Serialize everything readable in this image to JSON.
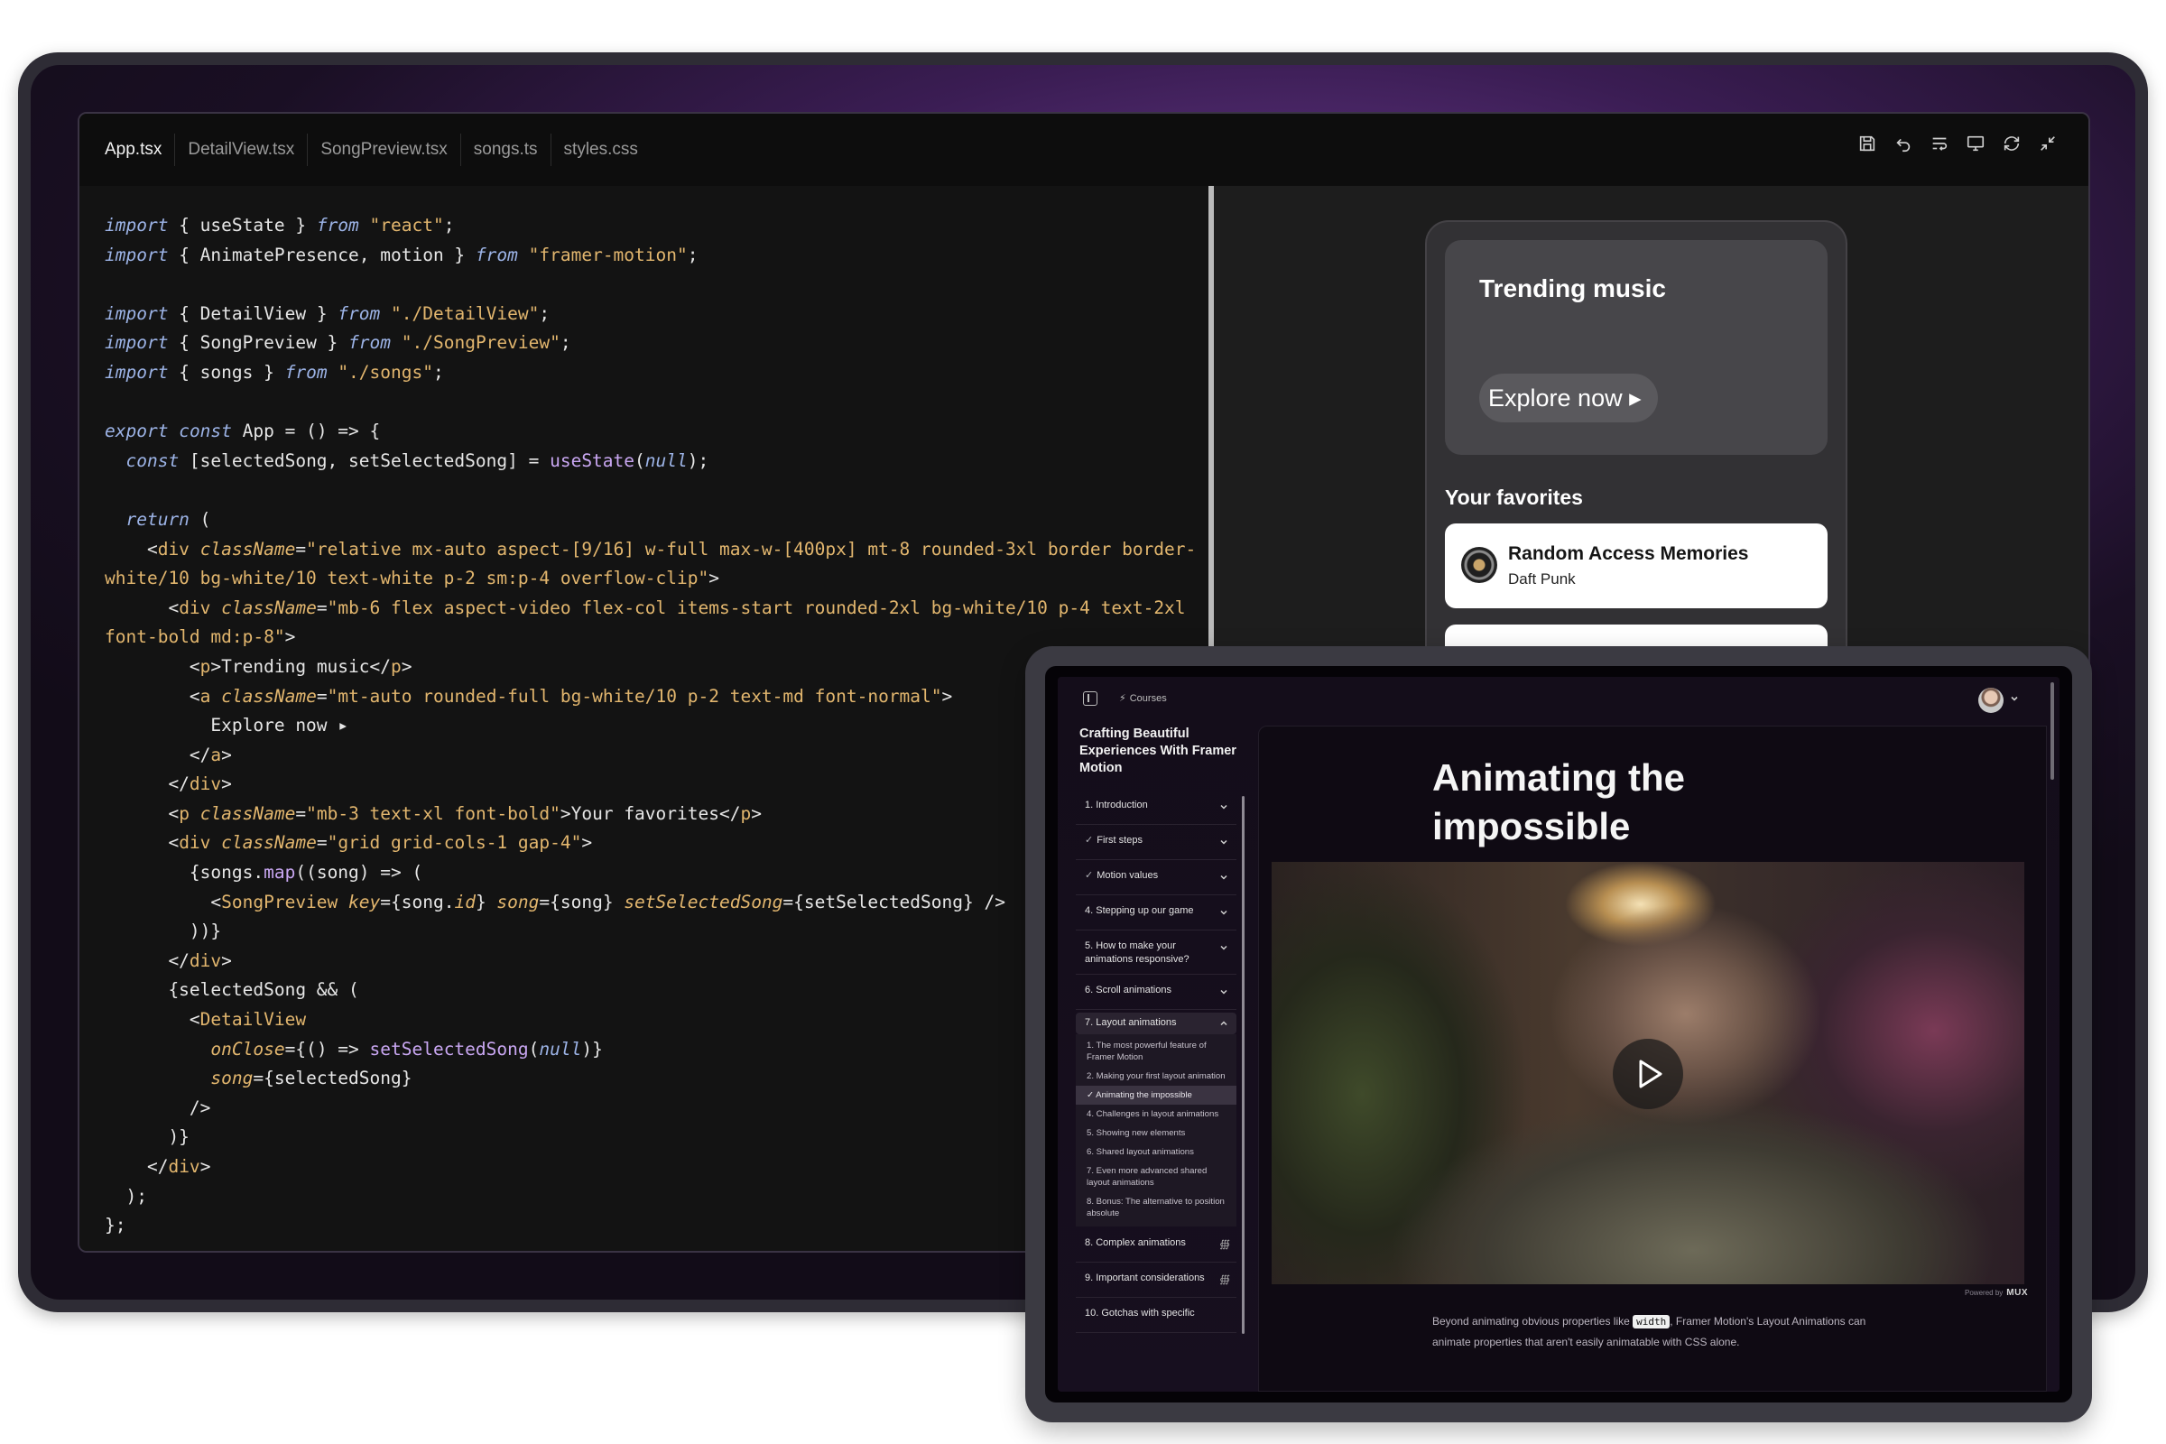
{
  "editor": {
    "tabs": [
      "App.tsx",
      "DetailView.tsx",
      "SongPreview.tsx",
      "songs.ts",
      "styles.css"
    ],
    "toolbar_icons": [
      "save-icon",
      "undo-icon",
      "wrap-icon",
      "preview-icon",
      "refresh-icon",
      "collapse-icon"
    ],
    "code_lines": [
      [
        [
          "kw",
          "import"
        ],
        [
          "t",
          " { useState } "
        ],
        [
          "kw",
          "from"
        ],
        [
          "t",
          " "
        ],
        [
          "str",
          "\"react\""
        ],
        [
          "t",
          ";"
        ]
      ],
      [
        [
          "kw",
          "import"
        ],
        [
          "t",
          " { AnimatePresence, motion } "
        ],
        [
          "kw",
          "from"
        ],
        [
          "t",
          " "
        ],
        [
          "str",
          "\"framer-motion\""
        ],
        [
          "t",
          ";"
        ]
      ],
      [],
      [
        [
          "kw",
          "import"
        ],
        [
          "t",
          " { DetailView } "
        ],
        [
          "kw",
          "from"
        ],
        [
          "t",
          " "
        ],
        [
          "str",
          "\"./DetailView\""
        ],
        [
          "t",
          ";"
        ]
      ],
      [
        [
          "kw",
          "import"
        ],
        [
          "t",
          " { SongPreview } "
        ],
        [
          "kw",
          "from"
        ],
        [
          "t",
          " "
        ],
        [
          "str",
          "\"./SongPreview\""
        ],
        [
          "t",
          ";"
        ]
      ],
      [
        [
          "kw",
          "import"
        ],
        [
          "t",
          " { songs } "
        ],
        [
          "kw",
          "from"
        ],
        [
          "t",
          " "
        ],
        [
          "str",
          "\"./songs\""
        ],
        [
          "t",
          ";"
        ]
      ],
      [],
      [
        [
          "kw",
          "export"
        ],
        [
          "t",
          " "
        ],
        [
          "kw",
          "const"
        ],
        [
          "t",
          " App = () => {"
        ]
      ],
      [
        [
          "t",
          "  "
        ],
        [
          "kw",
          "const"
        ],
        [
          "t",
          " [selectedSong, setSelectedSong] = "
        ],
        [
          "fn",
          "useState"
        ],
        [
          "t",
          "("
        ],
        [
          "nl",
          "null"
        ],
        [
          "t",
          ");"
        ]
      ],
      [],
      [
        [
          "t",
          "  "
        ],
        [
          "kw",
          "return"
        ],
        [
          "t",
          " ("
        ]
      ],
      [
        [
          "t",
          "    <"
        ],
        [
          "tag",
          "div"
        ],
        [
          "t",
          " "
        ],
        [
          "attr",
          "className"
        ],
        [
          "t",
          "="
        ],
        [
          "str",
          "\"relative mx-auto aspect-[9/16] w-full max-w-[400px] mt-8 rounded-3xl border border-"
        ]
      ],
      [
        [
          "str",
          "white/10 bg-white/10 text-white p-2 sm:p-4 overflow-clip\""
        ],
        [
          "t",
          ">"
        ]
      ],
      [
        [
          "t",
          "      <"
        ],
        [
          "tag",
          "div"
        ],
        [
          "t",
          " "
        ],
        [
          "attr",
          "className"
        ],
        [
          "t",
          "="
        ],
        [
          "str",
          "\"mb-6 flex aspect-video flex-col items-start rounded-2xl bg-white/10 p-4 text-2xl"
        ]
      ],
      [
        [
          "str",
          "font-bold md:p-8\""
        ],
        [
          "t",
          ">"
        ]
      ],
      [
        [
          "t",
          "        <"
        ],
        [
          "tag",
          "p"
        ],
        [
          "t",
          ">Trending music</"
        ],
        [
          "tag",
          "p"
        ],
        [
          "t",
          ">"
        ]
      ],
      [
        [
          "t",
          "        <"
        ],
        [
          "tag",
          "a"
        ],
        [
          "t",
          " "
        ],
        [
          "attr",
          "className"
        ],
        [
          "t",
          "="
        ],
        [
          "str",
          "\"mt-auto rounded-full bg-white/10 p-2 text-md font-normal\""
        ],
        [
          "t",
          ">"
        ]
      ],
      [
        [
          "t",
          "          Explore now ▸"
        ]
      ],
      [
        [
          "t",
          "        </"
        ],
        [
          "tag",
          "a"
        ],
        [
          "t",
          ">"
        ]
      ],
      [
        [
          "t",
          "      </"
        ],
        [
          "tag",
          "div"
        ],
        [
          "t",
          ">"
        ]
      ],
      [
        [
          "t",
          "      <"
        ],
        [
          "tag",
          "p"
        ],
        [
          "t",
          " "
        ],
        [
          "attr",
          "className"
        ],
        [
          "t",
          "="
        ],
        [
          "str",
          "\"mb-3 text-xl font-bold\""
        ],
        [
          "t",
          ">Your favorites</"
        ],
        [
          "tag",
          "p"
        ],
        [
          "t",
          ">"
        ]
      ],
      [
        [
          "t",
          "      <"
        ],
        [
          "tag",
          "div"
        ],
        [
          "t",
          " "
        ],
        [
          "attr",
          "className"
        ],
        [
          "t",
          "="
        ],
        [
          "str",
          "\"grid grid-cols-1 gap-4\""
        ],
        [
          "t",
          ">"
        ]
      ],
      [
        [
          "t",
          "        {songs."
        ],
        [
          "fn",
          "map"
        ],
        [
          "t",
          "((song) => ("
        ]
      ],
      [
        [
          "t",
          "          <"
        ],
        [
          "tag",
          "SongPreview"
        ],
        [
          "t",
          " "
        ],
        [
          "attr",
          "key"
        ],
        [
          "t",
          "={song."
        ],
        [
          "attr",
          "id"
        ],
        [
          "t",
          "} "
        ],
        [
          "attr",
          "song"
        ],
        [
          "t",
          "={song} "
        ],
        [
          "attr",
          "setSelectedSong"
        ],
        [
          "t",
          "={setSelectedSong} />"
        ]
      ],
      [
        [
          "t",
          "        ))}"
        ]
      ],
      [
        [
          "t",
          "      </"
        ],
        [
          "tag",
          "div"
        ],
        [
          "t",
          ">"
        ]
      ],
      [
        [
          "t",
          "      {selectedSong && ("
        ]
      ],
      [
        [
          "t",
          "        <"
        ],
        [
          "tag",
          "DetailView"
        ]
      ],
      [
        [
          "t",
          "          "
        ],
        [
          "attr",
          "onClose"
        ],
        [
          "t",
          "={() => "
        ],
        [
          "fn",
          "setSelectedSong"
        ],
        [
          "t",
          "("
        ],
        [
          "nl",
          "null"
        ],
        [
          "t",
          ")}"
        ]
      ],
      [
        [
          "t",
          "          "
        ],
        [
          "attr",
          "song"
        ],
        [
          "t",
          "={selectedSong}"
        ]
      ],
      [
        [
          "t",
          "        />"
        ]
      ],
      [
        [
          "t",
          "      )}"
        ]
      ],
      [
        [
          "t",
          "    </"
        ],
        [
          "tag",
          "div"
        ],
        [
          "t",
          ">"
        ]
      ],
      [
        [
          "t",
          "  );"
        ]
      ],
      [
        [
          "t",
          "};"
        ]
      ]
    ]
  },
  "preview": {
    "trending_title": "Trending music",
    "explore_label": "Explore now ▸",
    "favorites_title": "Your favorites",
    "song": {
      "title": "Random Access Memories",
      "artist": "Daft Punk"
    }
  },
  "course_app": {
    "crumb": "Courses",
    "course_title": "Crafting Beautiful Experiences With Framer Motion",
    "chapters": [
      {
        "label": "1. Introduction",
        "check": false,
        "marker": "chevron"
      },
      {
        "label": "First steps",
        "check": true,
        "marker": "chevron"
      },
      {
        "label": "Motion values",
        "check": true,
        "marker": "chevron"
      },
      {
        "label": "4. Stepping up our game",
        "check": false,
        "marker": "chevron"
      },
      {
        "label": "5. How to make your animations responsive?",
        "check": false,
        "marker": "chevron",
        "tall": true
      },
      {
        "label": "6. Scroll animations",
        "check": false,
        "marker": "chevron"
      },
      {
        "label": "7. Layout animations",
        "check": false,
        "marker": "chevron-up",
        "open": true
      }
    ],
    "sub_lessons": [
      {
        "label": "1. The most powerful feature of Framer Motion",
        "active": false
      },
      {
        "label": "2. Making your first layout animation",
        "active": false
      },
      {
        "label": "✓ Animating the impossible",
        "active": true
      },
      {
        "label": "4. Challenges in layout animations",
        "active": false
      },
      {
        "label": "5. Showing new elements",
        "active": false
      },
      {
        "label": "6. Shared layout animations",
        "active": false
      },
      {
        "label": "7. Even more advanced shared layout animations",
        "active": false
      },
      {
        "label": "8. Bonus: The alternative to position absolute",
        "active": false
      }
    ],
    "later_chapters": [
      {
        "label": "8. Complex animations",
        "marker": "∰"
      },
      {
        "label": "9. Important considerations",
        "marker": "∰"
      },
      {
        "label": "10. Gotchas with specific",
        "marker": ""
      }
    ],
    "lesson_title": "Animating the impossible",
    "powered_by": "Powered by",
    "powered_brand": "MUX",
    "desc_before": "Beyond animating obvious properties like",
    "desc_code": "width",
    "desc_after": ", Framer Motion's Layout Animations can animate properties that aren't easily animatable with CSS alone."
  }
}
